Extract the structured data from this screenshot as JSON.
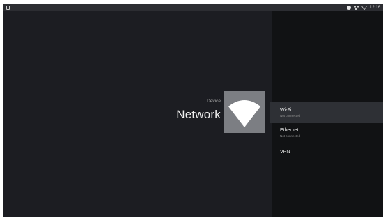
{
  "status_bar": {
    "time": "12:16"
  },
  "header": {
    "breadcrumb": "Device",
    "title": "Network",
    "hero_icon": "wifi-icon"
  },
  "menu": {
    "items": [
      {
        "label": "Wi-Fi",
        "sublabel": "Not connected",
        "selected": true
      },
      {
        "label": "Ethernet",
        "sublabel": "Not connected",
        "selected": false
      },
      {
        "label": "VPN",
        "sublabel": "",
        "selected": false
      }
    ]
  },
  "colors": {
    "background": "#1c1d22",
    "panel": "#111214",
    "selected_item": "#2e3035",
    "icon_tile": "#7c7e83"
  }
}
